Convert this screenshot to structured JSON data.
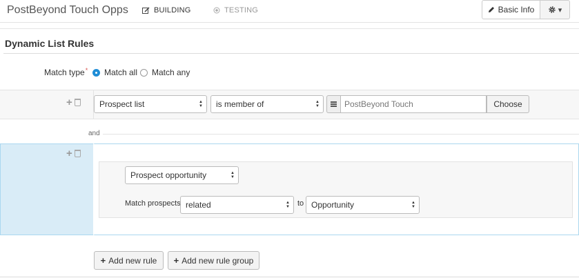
{
  "header": {
    "app_title": "PostBeyond Touch Opps",
    "tabs": [
      {
        "label": "BUILDING",
        "icon": "edit-icon",
        "active": true
      },
      {
        "label": "TESTING",
        "icon": "target-icon",
        "active": false
      }
    ],
    "basic_info_label": "Basic Info",
    "settings_icon": "gear-icon"
  },
  "section": {
    "title": "Dynamic List Rules"
  },
  "match_type": {
    "label": "Match type",
    "required_mark": "*",
    "options": [
      {
        "label": "Match all",
        "selected": true
      },
      {
        "label": "Match any",
        "selected": false
      }
    ]
  },
  "rule1": {
    "field": "Prospect list",
    "operator": "is member of",
    "value_placeholder": "PostBeyond Touch",
    "choose_label": "Choose"
  },
  "connector": "and",
  "group": {
    "field": "Prospect opportunity",
    "match_prospects_label": "Match prospects",
    "relation": "related",
    "to_label": "to",
    "target": "Opportunity"
  },
  "actions": {
    "add_rule": "Add new rule",
    "add_group": "Add new rule group"
  },
  "colors": {
    "accent": "#1f8dd6",
    "group_bg": "#d9ecf7",
    "group_border": "#aad7ef",
    "required": "#d9534f"
  }
}
